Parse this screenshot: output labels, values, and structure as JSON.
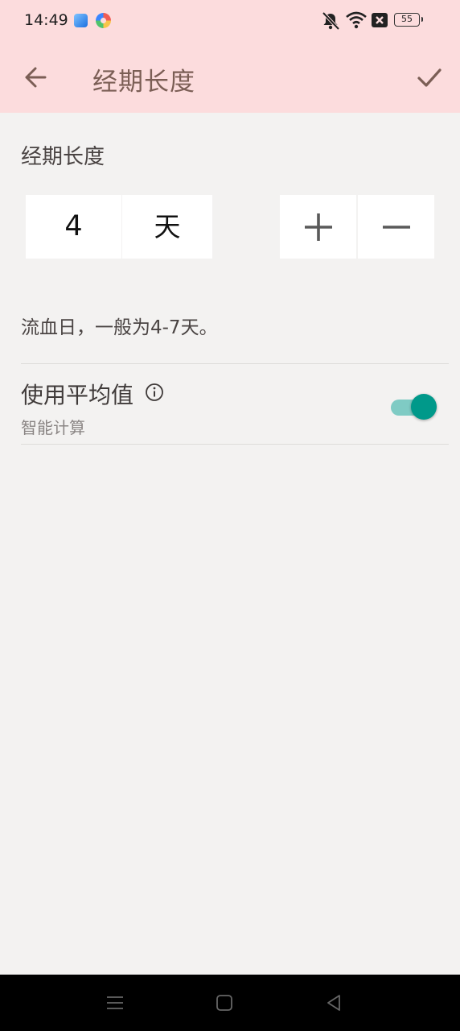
{
  "status_bar": {
    "time": "14:49",
    "battery": "55",
    "icons": [
      "app-icon-blue",
      "app-icon-colorful",
      "bell-muted-icon",
      "wifi-icon",
      "sim-x-icon",
      "battery-icon"
    ]
  },
  "app_bar": {
    "title": "经期长度",
    "back_icon": "arrow-left-icon",
    "confirm_icon": "check-icon",
    "background": "#fcdcdd",
    "title_color": "#7b5e55"
  },
  "period_length": {
    "section_title": "经期长度",
    "value": "4",
    "unit": "天",
    "increment_icon": "plus-icon",
    "decrement_icon": "minus-icon",
    "hint": "流血日，一般为4-7天。"
  },
  "average_setting": {
    "title": "使用平均值",
    "subtitle": "智能计算",
    "info_icon": "info-icon",
    "enabled": true,
    "accent": "#00998a"
  },
  "nav_bar": {
    "icons": [
      "menu-icon",
      "home-icon",
      "back-triangle-icon"
    ]
  }
}
